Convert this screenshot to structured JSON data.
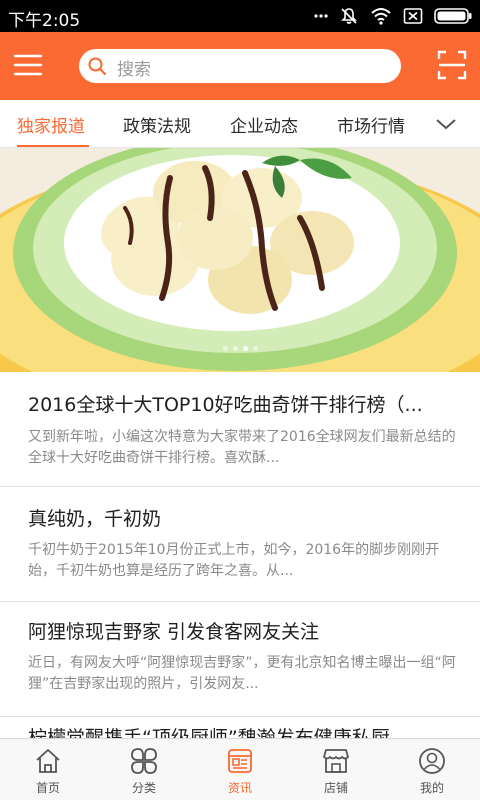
{
  "status_bar": {
    "time": "下午2:05"
  },
  "header": {
    "search_placeholder": "搜索"
  },
  "tabs": [
    {
      "label": "独家报道",
      "active": true
    },
    {
      "label": "政策法规",
      "active": false
    },
    {
      "label": "企业动态",
      "active": false
    },
    {
      "label": "市场行情",
      "active": false
    }
  ],
  "banner": {
    "slide_count": 4,
    "active_slide": 3
  },
  "news": [
    {
      "title": "2016全球十大TOP10好吃曲奇饼干排行榜（...",
      "summary": "又到新年啦，小编这次特意为大家带来了2016全球网友们最新总结的全球十大好吃曲奇饼干排行榜。喜欢酥..."
    },
    {
      "title": "真纯奶，千初奶",
      "summary": "千初牛奶于2015年10月份正式上市，如今，2016年的脚步刚刚开始，千初牛奶也算是经历了跨年之喜。从..."
    },
    {
      "title": "阿狸惊现吉野家 引发食客网友关注",
      "summary": "近日，有网友大呼“阿狸惊现吉野家”，更有北京知名博主曝出一组“阿狸”在吉野家出现的照片，引发网友..."
    },
    {
      "title": "柠檬觉醒携手“顶级厨师”魏瀚发布健康私厨",
      "summary": ""
    }
  ],
  "bottom_nav": [
    {
      "label": "首页",
      "icon": "home-icon",
      "active": false
    },
    {
      "label": "分类",
      "icon": "category-icon",
      "active": false
    },
    {
      "label": "资讯",
      "icon": "news-icon",
      "active": true
    },
    {
      "label": "店铺",
      "icon": "store-icon",
      "active": false
    },
    {
      "label": "我的",
      "icon": "profile-icon",
      "active": false
    }
  ],
  "colors": {
    "accent": "#fb6a32",
    "status_bar": "#000000",
    "text": "#1f1f1f",
    "muted": "#8a8a8a"
  }
}
